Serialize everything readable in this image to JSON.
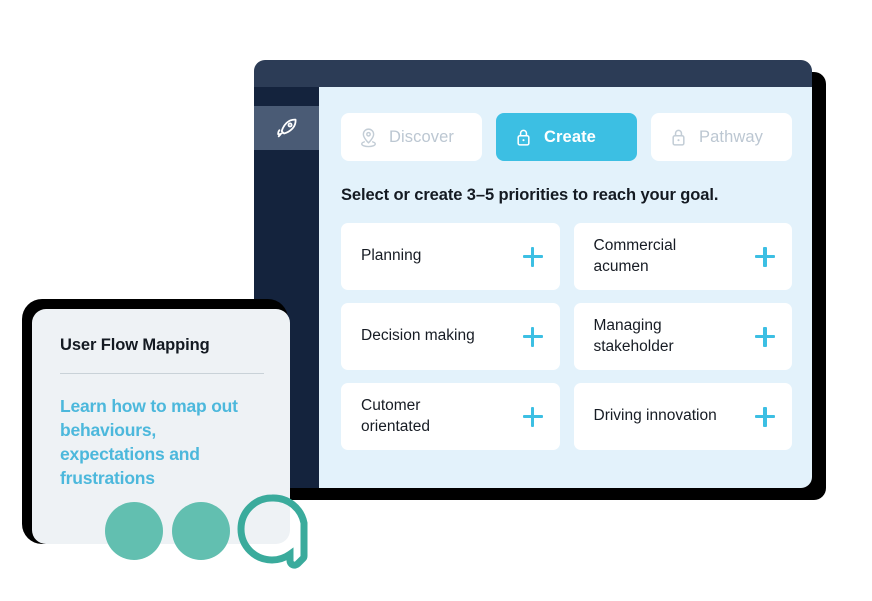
{
  "app_window": {
    "sidebar": {
      "items": [
        {
          "icon": "rocket-icon",
          "active": true
        }
      ]
    },
    "tabs": [
      {
        "id": "discover",
        "label": "Discover",
        "icon": "map-pin-icon",
        "active": false
      },
      {
        "id": "create",
        "label": "Create",
        "icon": "lock-icon",
        "active": true
      },
      {
        "id": "pathway",
        "label": "Pathway",
        "icon": "lock-icon",
        "active": false
      }
    ],
    "heading": "Select or create 3–5 priorities to reach your goal.",
    "priorities": [
      {
        "label": "Planning",
        "action": "+"
      },
      {
        "label": "Commercial acumen",
        "action": "+"
      },
      {
        "label": "Decision making",
        "action": "+"
      },
      {
        "label": "Managing stakeholder",
        "action": "+"
      },
      {
        "label": "Cutomer orientated",
        "action": "+"
      },
      {
        "label": "Driving innovation",
        "action": "+"
      }
    ]
  },
  "info_card": {
    "title": "User Flow Mapping",
    "body": "Learn how to map out behaviours, expectations and frustrations"
  },
  "colors": {
    "accent_cyan": "#3cbfe3",
    "body_cyan": "#4cb8dc",
    "teal": "#62bfb0",
    "titlebar_navy": "#2c3c56",
    "sidebar_navy": "#14233d",
    "sidebar_active": "#4a5b75",
    "content_bg": "#e3f2fb",
    "info_card_bg": "#eef2f5",
    "shadow": "#000000"
  }
}
